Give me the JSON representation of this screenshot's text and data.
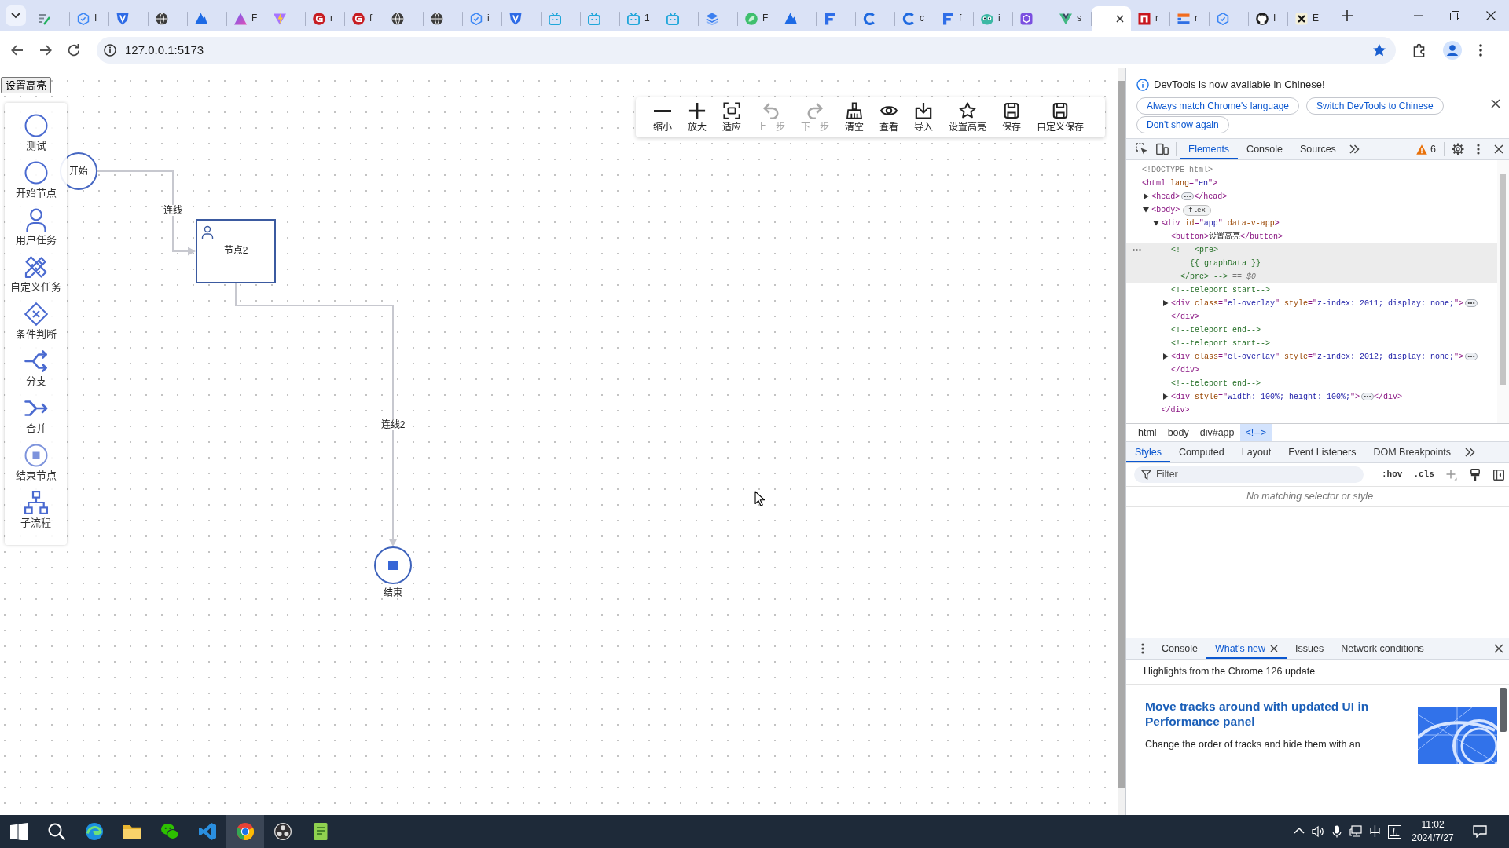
{
  "browser": {
    "tabs": [
      {
        "kind": "notes",
        "selected": false
      },
      {
        "kind": "hexagon",
        "title": "I",
        "selected": false
      },
      {
        "kind": "shield",
        "selected": false
      },
      {
        "kind": "globe",
        "selected": false
      },
      {
        "kind": "mountain",
        "selected": false
      },
      {
        "kind": "prism",
        "title": "F",
        "selected": false
      },
      {
        "kind": "vite",
        "selected": false
      },
      {
        "kind": "gitee",
        "title": "r",
        "selected": false
      },
      {
        "kind": "gitee",
        "title": "f",
        "selected": false
      },
      {
        "kind": "globe",
        "selected": false
      },
      {
        "kind": "globe",
        "selected": false
      },
      {
        "kind": "hexagon",
        "title": "i",
        "selected": false
      },
      {
        "kind": "shield",
        "selected": false
      },
      {
        "kind": "tv",
        "selected": false
      },
      {
        "kind": "tv",
        "selected": false
      },
      {
        "kind": "tv",
        "title": "1",
        "selected": false
      },
      {
        "kind": "tv",
        "selected": false
      },
      {
        "kind": "layers",
        "selected": false
      },
      {
        "kind": "leaf",
        "title": "F",
        "selected": false
      },
      {
        "kind": "mountain",
        "selected": false
      },
      {
        "kind": "fletter",
        "selected": false
      },
      {
        "kind": "cletter",
        "selected": false
      },
      {
        "kind": "cletter",
        "title": "c",
        "selected": false
      },
      {
        "kind": "fletter",
        "title": "f",
        "selected": false
      },
      {
        "kind": "chameleon",
        "title": "i",
        "selected": false
      },
      {
        "kind": "cube",
        "selected": false
      },
      {
        "kind": "vue",
        "title": "s",
        "selected": false
      },
      {
        "selected": true
      },
      {
        "kind": "npm",
        "title": "r",
        "selected": false
      },
      {
        "kind": "flag",
        "title": "r",
        "selected": false
      },
      {
        "kind": "hexagon",
        "selected": false
      },
      {
        "kind": "github",
        "title": "I",
        "selected": false
      },
      {
        "kind": "xlogo",
        "title": "E",
        "selected": false
      }
    ],
    "address": "127.0.0.1:5173",
    "bookmarked": true
  },
  "app": {
    "highlight_button": "设置高亮",
    "palette": [
      {
        "kind": "circle",
        "label": "测试"
      },
      {
        "kind": "circle",
        "label": "开始节点"
      },
      {
        "kind": "user",
        "label": "用户任务"
      },
      {
        "kind": "tools",
        "label": "自定义任务"
      },
      {
        "kind": "gateway",
        "label": "条件判断"
      },
      {
        "kind": "split",
        "label": "分支"
      },
      {
        "kind": "merge",
        "label": "合并"
      },
      {
        "kind": "end",
        "label": "结束节点"
      },
      {
        "kind": "subprocess",
        "label": "子流程"
      }
    ],
    "toolbar": [
      {
        "kind": "zoom_out",
        "label": "缩小",
        "disabled": false
      },
      {
        "kind": "zoom_in",
        "label": "放大",
        "disabled": false
      },
      {
        "kind": "fit",
        "label": "适应",
        "disabled": false
      },
      {
        "kind": "undo",
        "label": "上一步",
        "disabled": true
      },
      {
        "kind": "redo",
        "label": "下一步",
        "disabled": true
      },
      {
        "kind": "clear",
        "label": "清空",
        "disabled": false
      },
      {
        "kind": "view",
        "label": "查看",
        "disabled": false
      },
      {
        "kind": "import",
        "label": "导入",
        "disabled": false
      },
      {
        "kind": "highlight",
        "label": "设置高亮",
        "disabled": false
      },
      {
        "kind": "save",
        "label": "保存",
        "disabled": false
      },
      {
        "kind": "custom_save",
        "label": "自定义保存",
        "disabled": false
      }
    ],
    "diagram": {
      "nodes": [
        {
          "kind": "start",
          "label": "开始"
        },
        {
          "kind": "user_task",
          "label": "节点2"
        },
        {
          "kind": "end",
          "label": "结束"
        }
      ],
      "edges": [
        {
          "label": "连线"
        },
        {
          "label": "连线2"
        }
      ]
    }
  },
  "devtools": {
    "infobar": {
      "message": "DevTools is now available in Chinese!",
      "buttons": [
        "Always match Chrome's language",
        "Switch DevTools to Chinese",
        "Don't show again"
      ]
    },
    "tabs": [
      {
        "label": "Elements",
        "selected": true
      },
      {
        "label": "Console",
        "selected": false
      },
      {
        "label": "Sources",
        "selected": false
      }
    ],
    "warnings": "6",
    "dom_tree": [
      {
        "tokens": [
          {
            "kind": "doctype",
            "text": "<!DOCTYPE html>"
          }
        ],
        "selected": false
      },
      {
        "tokens": [
          {
            "kind": "tag",
            "text": "<html"
          },
          {
            "kind": "attr",
            "text": " lang"
          },
          {
            "kind": "tag",
            "text": "=\""
          },
          {
            "kind": "val",
            "text": "en"
          },
          {
            "kind": "tag",
            "text": "\">"
          }
        ],
        "selected": false,
        "children": [
          {
            "tokens": [
              {
                "kind": "tag",
                "text": "<head>"
              }
            ],
            "expanded": false,
            "close": [
              {
                "kind": "tag",
                "text": "</head>"
              }
            ],
            "selected": false
          },
          {
            "tokens": [
              {
                "kind": "tag",
                "text": "<body>"
              }
            ],
            "expanded": true,
            "badge": "flex",
            "selected": false,
            "children": [
              {
                "tokens": [
                  {
                    "kind": "tag",
                    "text": "<div"
                  },
                  {
                    "kind": "attr",
                    "text": " id"
                  },
                  {
                    "kind": "tag",
                    "text": "=\""
                  },
                  {
                    "kind": "val",
                    "text": "app"
                  },
                  {
                    "kind": "tag",
                    "text": "\""
                  },
                  {
                    "kind": "attr",
                    "text": " data-v-app"
                  },
                  {
                    "kind": "tag",
                    "text": ">"
                  }
                ],
                "expanded": true,
                "selected": false,
                "children": [
                  {
                    "tokens": [
                      {
                        "kind": "tag",
                        "text": "<button>"
                      },
                      {
                        "kind": "text",
                        "text": "设置高亮"
                      },
                      {
                        "kind": "tag",
                        "text": "</button>"
                      }
                    ],
                    "selected": false
                  },
                  {
                    "tokens": [
                      {
                        "kind": "comment",
                        "text": "<!-- <pre>\n    {{ graphData }}\n  </pre> -->"
                      },
                      {
                        "kind": "ref",
                        "text": " == $0"
                      }
                    ],
                    "selected": true
                  },
                  {
                    "tokens": [
                      {
                        "kind": "comment",
                        "text": "<!--teleport start-->"
                      }
                    ],
                    "selected": false
                  },
                  {
                    "tokens": [
                      {
                        "kind": "tag",
                        "text": "<div"
                      },
                      {
                        "kind": "attr",
                        "text": " class"
                      },
                      {
                        "kind": "tag",
                        "text": "=\""
                      },
                      {
                        "kind": "val",
                        "text": "el-overlay"
                      },
                      {
                        "kind": "tag",
                        "text": "\""
                      },
                      {
                        "kind": "attr",
                        "text": " style"
                      },
                      {
                        "kind": "tag",
                        "text": "=\""
                      },
                      {
                        "kind": "val",
                        "text": "z-index: 2011; display: none;"
                      },
                      {
                        "kind": "tag",
                        "text": "\">"
                      }
                    ],
                    "expanded": false,
                    "close": [
                      {
                        "kind": "tag",
                        "text": "</div>"
                      }
                    ],
                    "selected": false
                  },
                  {
                    "tokens": [
                      {
                        "kind": "comment",
                        "text": "<!--teleport end-->"
                      }
                    ],
                    "selected": false
                  },
                  {
                    "tokens": [
                      {
                        "kind": "comment",
                        "text": "<!--teleport start-->"
                      }
                    ],
                    "selected": false
                  },
                  {
                    "tokens": [
                      {
                        "kind": "tag",
                        "text": "<div"
                      },
                      {
                        "kind": "attr",
                        "text": " class"
                      },
                      {
                        "kind": "tag",
                        "text": "=\""
                      },
                      {
                        "kind": "val",
                        "text": "el-overlay"
                      },
                      {
                        "kind": "tag",
                        "text": "\""
                      },
                      {
                        "kind": "attr",
                        "text": " style"
                      },
                      {
                        "kind": "tag",
                        "text": "=\""
                      },
                      {
                        "kind": "val",
                        "text": "z-index: 2012; display: none;"
                      },
                      {
                        "kind": "tag",
                        "text": "\">"
                      }
                    ],
                    "expanded": false,
                    "close": [
                      {
                        "kind": "tag",
                        "text": "</div>"
                      }
                    ],
                    "selected": false
                  },
                  {
                    "tokens": [
                      {
                        "kind": "comment",
                        "text": "<!--teleport end-->"
                      }
                    ],
                    "selected": false
                  },
                  {
                    "tokens": [
                      {
                        "kind": "tag",
                        "text": "<div"
                      },
                      {
                        "kind": "attr",
                        "text": " style"
                      },
                      {
                        "kind": "tag",
                        "text": "=\""
                      },
                      {
                        "kind": "val",
                        "text": "width: 100%; height: 100%;"
                      },
                      {
                        "kind": "tag",
                        "text": "\">"
                      }
                    ],
                    "expanded": false,
                    "close": [
                      {
                        "kind": "tag",
                        "text": "</div>"
                      }
                    ],
                    "selected": false
                  }
                ],
                "close": [
                  {
                    "kind": "tag",
                    "text": "</div>"
                  }
                ]
              }
            ]
          }
        ]
      }
    ],
    "breadcrumbs": [
      {
        "label": "html",
        "selected": false
      },
      {
        "label": "body",
        "selected": false
      },
      {
        "label": "div#app",
        "selected": false
      },
      {
        "label": "<!-->",
        "selected": true
      }
    ],
    "sidebar_tabs": [
      {
        "label": "Styles",
        "selected": true
      },
      {
        "label": "Computed",
        "selected": false
      },
      {
        "label": "Layout",
        "selected": false
      },
      {
        "label": "Event Listeners",
        "selected": false
      },
      {
        "label": "DOM Breakpoints",
        "selected": false
      }
    ],
    "filter": {
      "placeholder": "Filter"
    },
    "state_buttons": [
      ":hov",
      ".cls"
    ],
    "styles_message": "No matching selector or style",
    "drawer": {
      "tabs": [
        {
          "label": "Console",
          "selected": false,
          "closable": false
        },
        {
          "label": "What's new",
          "selected": true,
          "closable": true
        },
        {
          "label": "Issues",
          "selected": false,
          "closable": false
        },
        {
          "label": "Network conditions",
          "selected": false,
          "closable": false
        }
      ],
      "subtitle": "Highlights from the Chrome 126 update",
      "article": {
        "heading": "Move tracks around with updated UI in Performance panel",
        "text": "Change the order of tracks and hide them with an"
      }
    }
  },
  "taskbar": {
    "apps": [
      {
        "kind": "start",
        "selected": false
      },
      {
        "kind": "search",
        "selected": false
      },
      {
        "kind": "edge",
        "selected": false
      },
      {
        "kind": "folder",
        "selected": false
      },
      {
        "kind": "wechat",
        "selected": false
      },
      {
        "kind": "vscode",
        "selected": false
      },
      {
        "kind": "chrome",
        "selected": true
      },
      {
        "kind": "obs",
        "selected": false
      },
      {
        "kind": "notepad",
        "selected": false
      }
    ],
    "language": "中",
    "input_mode": "五",
    "time": "11:02",
    "date": "2024/7/27"
  }
}
